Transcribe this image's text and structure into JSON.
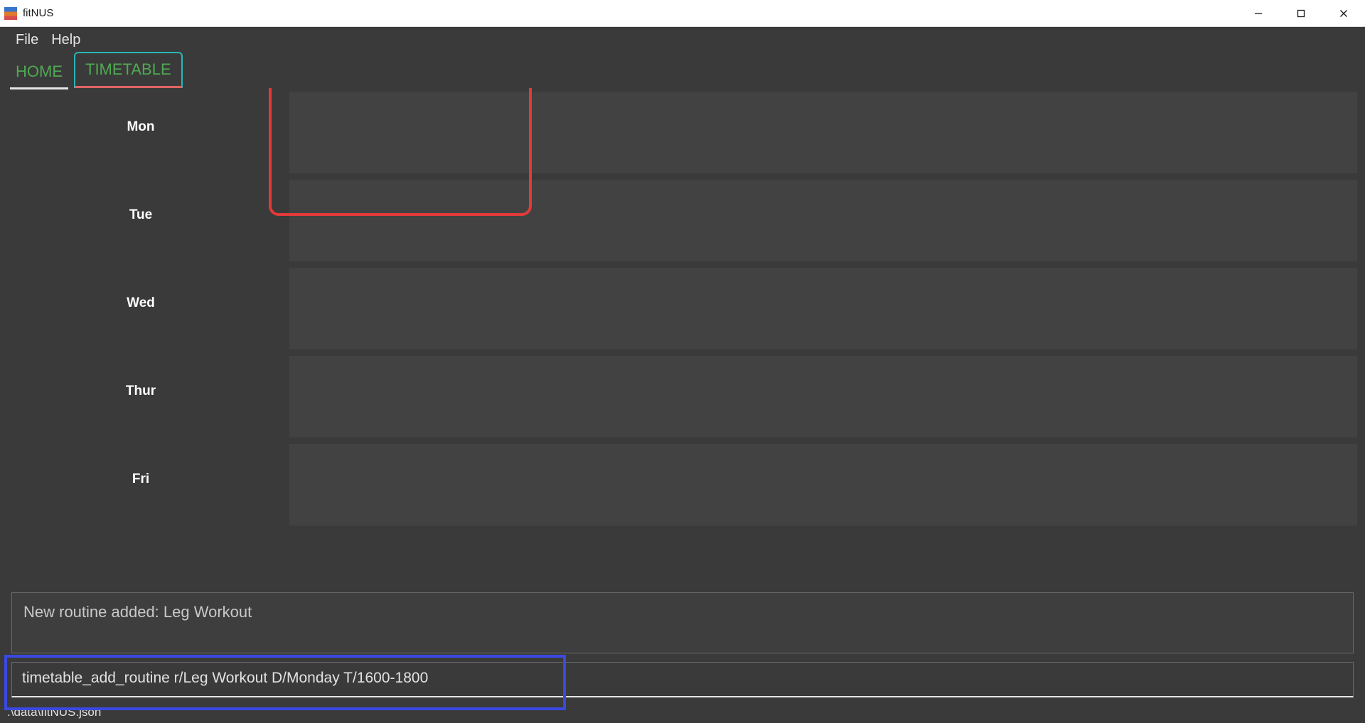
{
  "window": {
    "title": "fitNUS"
  },
  "menu": {
    "file": "File",
    "help": "Help"
  },
  "tabs": {
    "home": "HOME",
    "timetable": "TIMETABLE"
  },
  "timetable": {
    "days": [
      "Mon",
      "Tue",
      "Wed",
      "Thur",
      "Fri"
    ]
  },
  "message": {
    "text": "New routine added: Leg Workout"
  },
  "command": {
    "value": "timetable_add_routine r/Leg Workout D/Monday T/1600-1800"
  },
  "statusbar": {
    "path": ".\\data\\fitNUS.json"
  }
}
